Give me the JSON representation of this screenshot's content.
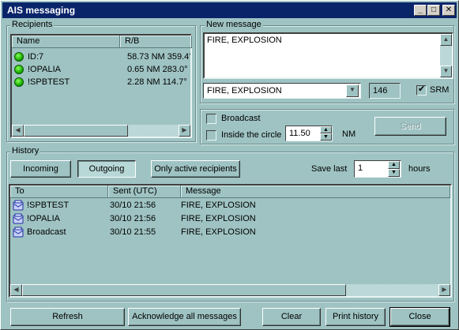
{
  "window": {
    "title": "AIS messaging"
  },
  "title_buttons": {
    "minimize": "_",
    "maximize": "□",
    "close": "✕"
  },
  "recipients": {
    "group_label": "Recipients",
    "columns": [
      "Name",
      "R/B"
    ],
    "rows": [
      {
        "name": "ID:7",
        "rb": "58.73 NM 359.4°"
      },
      {
        "name": "!OPALIA",
        "rb": "0.65 NM 283.0°"
      },
      {
        "name": "!SPBTEST",
        "rb": "2.28 NM 114.7°"
      }
    ]
  },
  "new_message": {
    "group_label": "New message",
    "text": "FIRE, EXPLOSION",
    "template_selected": "FIRE, EXPLOSION",
    "char_count": "146",
    "srm_label": "SRM",
    "srm_checked": true
  },
  "send_options": {
    "broadcast_label": "Broadcast",
    "broadcast_checked": false,
    "circle_label": "Inside the circle",
    "circle_checked": false,
    "circle_value": "11.50",
    "circle_unit": "NM",
    "send_label": "Send"
  },
  "history": {
    "group_label": "History",
    "incoming_label": "Incoming",
    "outgoing_label": "Outgoing",
    "active_label": "Only active recipients",
    "save_last_label": "Save last",
    "save_last_value": "1",
    "hours_label": "hours",
    "columns": [
      "To",
      "Sent (UTC)",
      "Message"
    ],
    "rows": [
      {
        "to": "!SPBTEST",
        "sent": "30/10 21:56",
        "message": "FIRE, EXPLOSION"
      },
      {
        "to": "!OPALIA",
        "sent": "30/10 21:56",
        "message": "FIRE, EXPLOSION"
      },
      {
        "to": "Broadcast",
        "sent": "30/10 21:55",
        "message": "FIRE, EXPLOSION"
      }
    ]
  },
  "footer": {
    "refresh": "Refresh",
    "acknowledge": "Acknowledge all messages",
    "clear": "Clear",
    "print_history": "Print history",
    "close": "Close"
  },
  "colors": {
    "background": "#9fc3c3",
    "titlebar": "#0a246a",
    "status_online": "#17b000"
  }
}
